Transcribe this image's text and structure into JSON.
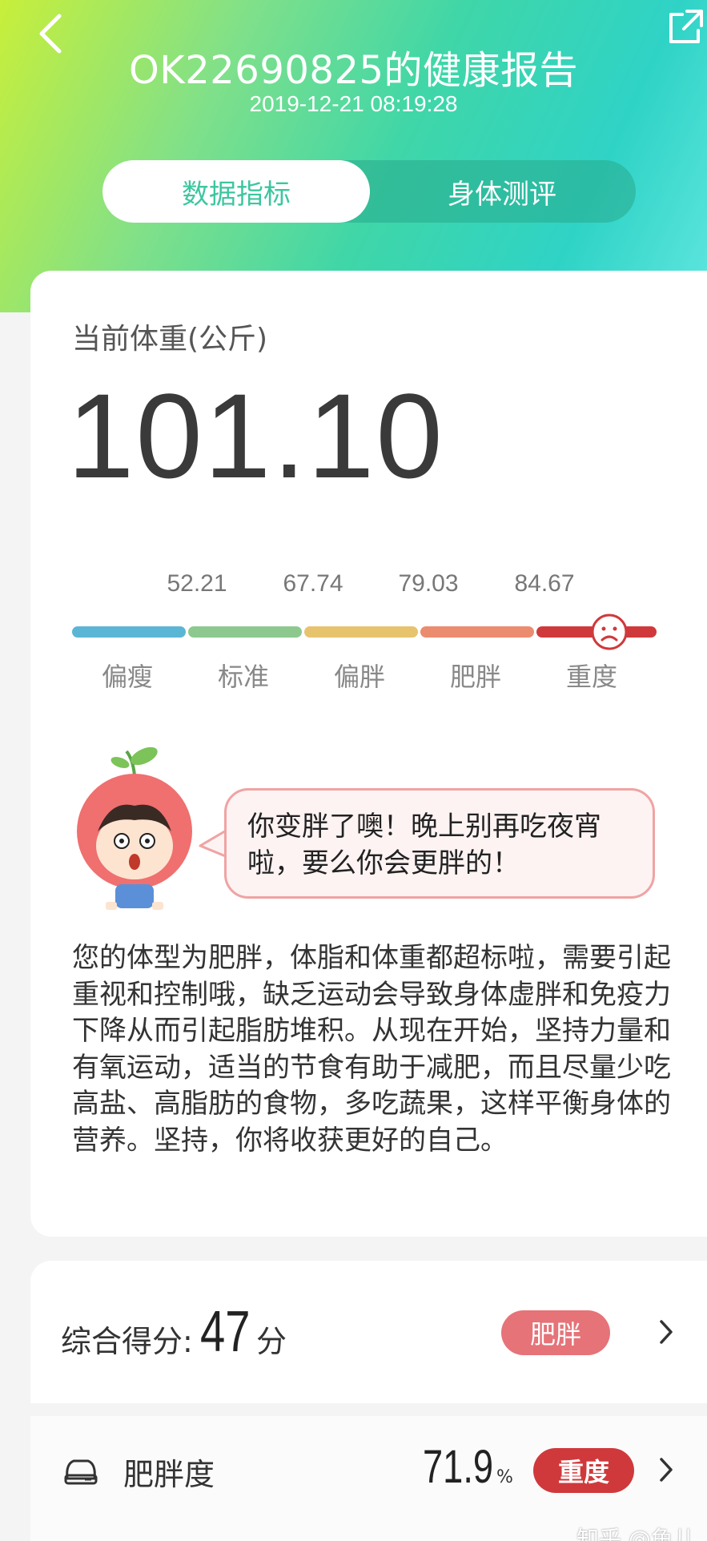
{
  "header": {
    "title": "OK22690825的健康报告",
    "timestamp": "2019-12-21 08:19:28"
  },
  "tabs": [
    {
      "label": "数据指标",
      "active": true
    },
    {
      "label": "身体测评",
      "active": false
    }
  ],
  "weight": {
    "label": "当前体重(公斤)",
    "value": "101.10"
  },
  "scale": {
    "thresholds": [
      "52.21",
      "67.74",
      "79.03",
      "84.67"
    ],
    "categories": [
      "偏瘦",
      "标准",
      "偏胖",
      "肥胖",
      "重度"
    ],
    "colors": [
      "#5bb6d5",
      "#8dc98f",
      "#e7c36d",
      "#ec8c6e",
      "#d0393b"
    ],
    "current_category": "重度"
  },
  "mascot_message": "你变胖了噢！晚上别再吃夜宵啦，要么你会更胖的！",
  "description": "您的体型为肥胖，体脂和体重都超标啦，需要引起重视和控制哦，缺乏运动会导致身体虚胖和免疫力下降从而引起脂肪堆积。从现在开始，坚持力量和有氧运动，适当的节食有助于减肥，而且尽量少吃高盐、高脂肪的食物，多吃蔬果，这样平衡身体的营养。坚持，你将收获更好的自己。",
  "score": {
    "label": "综合得分:",
    "value": "47",
    "unit": "分",
    "badge": "肥胖",
    "badge_color": "#e57378"
  },
  "fat": {
    "label": "肥胖度",
    "value": "71.9",
    "unit": "%",
    "badge": "重度",
    "badge_color": "#d0393b"
  },
  "watermark": "知乎 @鱼儿",
  "icons": [
    "back-arrow-icon",
    "share-icon",
    "sad-face-icon",
    "scale-icon",
    "chevron-right-icon"
  ]
}
